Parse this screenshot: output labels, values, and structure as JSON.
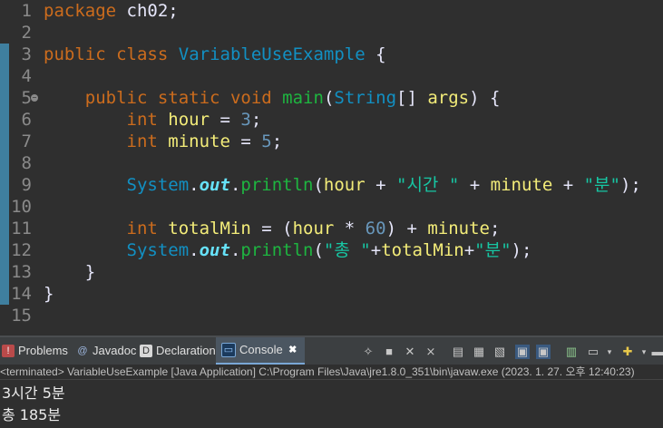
{
  "editor": {
    "lines": [
      {
        "n": "1",
        "tokens": [
          [
            "kw",
            "package"
          ],
          [
            "op",
            " ch02;"
          ]
        ]
      },
      {
        "n": "2",
        "tokens": []
      },
      {
        "n": "3",
        "tokens": [
          [
            "kw",
            "public"
          ],
          [
            "op",
            " "
          ],
          [
            "kw",
            "class"
          ],
          [
            "op",
            " "
          ],
          [
            "cls",
            "VariableUseExample"
          ],
          [
            "op",
            " {"
          ]
        ]
      },
      {
        "n": "4",
        "tokens": []
      },
      {
        "n": "5",
        "tokens": [
          [
            "op",
            "    "
          ],
          [
            "kw",
            "public"
          ],
          [
            "op",
            " "
          ],
          [
            "kw",
            "static"
          ],
          [
            "op",
            " "
          ],
          [
            "kw",
            "void"
          ],
          [
            "op",
            " "
          ],
          [
            "fn",
            "main"
          ],
          [
            "op",
            "("
          ],
          [
            "cls",
            "String"
          ],
          [
            "op",
            "[] "
          ],
          [
            "var",
            "args"
          ],
          [
            "op",
            ") {"
          ]
        ]
      },
      {
        "n": "6",
        "tokens": [
          [
            "op",
            "        "
          ],
          [
            "kw",
            "int"
          ],
          [
            "op",
            " "
          ],
          [
            "var",
            "hour"
          ],
          [
            "op",
            " = "
          ],
          [
            "num",
            "3"
          ],
          [
            "op",
            ";"
          ]
        ]
      },
      {
        "n": "7",
        "tokens": [
          [
            "op",
            "        "
          ],
          [
            "kw",
            "int"
          ],
          [
            "op",
            " "
          ],
          [
            "var",
            "minute"
          ],
          [
            "op",
            " = "
          ],
          [
            "num",
            "5"
          ],
          [
            "op",
            ";"
          ]
        ]
      },
      {
        "n": "8",
        "tokens": []
      },
      {
        "n": "9",
        "tokens": [
          [
            "op",
            "        "
          ],
          [
            "cls",
            "System"
          ],
          [
            "op",
            "."
          ],
          [
            "field",
            "out"
          ],
          [
            "op",
            "."
          ],
          [
            "fn",
            "println"
          ],
          [
            "op",
            "("
          ],
          [
            "var",
            "hour"
          ],
          [
            "op",
            " + "
          ],
          [
            "str",
            "\"시간 \""
          ],
          [
            "op",
            " + "
          ],
          [
            "var",
            "minute"
          ],
          [
            "op",
            " + "
          ],
          [
            "str",
            "\"분\""
          ],
          [
            "op",
            ");"
          ]
        ]
      },
      {
        "n": "10",
        "tokens": []
      },
      {
        "n": "11",
        "tokens": [
          [
            "op",
            "        "
          ],
          [
            "kw",
            "int"
          ],
          [
            "op",
            " "
          ],
          [
            "var",
            "totalMin"
          ],
          [
            "op",
            " = ("
          ],
          [
            "var",
            "hour"
          ],
          [
            "op",
            " * "
          ],
          [
            "num",
            "60"
          ],
          [
            "op",
            ") + "
          ],
          [
            "var",
            "minute"
          ],
          [
            "op",
            ";"
          ]
        ]
      },
      {
        "n": "12",
        "tokens": [
          [
            "op",
            "        "
          ],
          [
            "cls",
            "System"
          ],
          [
            "op",
            "."
          ],
          [
            "field",
            "out"
          ],
          [
            "op",
            "."
          ],
          [
            "fn",
            "println"
          ],
          [
            "op",
            "("
          ],
          [
            "str",
            "\"총 \""
          ],
          [
            "op",
            "+"
          ],
          [
            "var",
            "totalMin"
          ],
          [
            "op",
            "+"
          ],
          [
            "str",
            "\"분\""
          ],
          [
            "op",
            ");"
          ]
        ]
      },
      {
        "n": "13",
        "tokens": [
          [
            "op",
            "    }"
          ]
        ]
      },
      {
        "n": "14",
        "tokens": [
          [
            "op",
            "}"
          ]
        ]
      },
      {
        "n": "15",
        "tokens": []
      }
    ]
  },
  "tabs": {
    "problems": "Problems",
    "javadoc": "Javadoc",
    "declaration": "Declaration",
    "console": "Console"
  },
  "icons": {
    "problems": "problems-icon",
    "javadoc": "javadoc-icon",
    "declaration": "declaration-icon",
    "console": "console-icon",
    "close": "close-icon"
  },
  "console": {
    "status": "<terminated> VariableUseExample [Java Application] C:\\Program Files\\Java\\jre1.8.0_351\\bin\\javaw.exe  (2023. 1. 27. 오후 12:40:23)",
    "output": [
      "3시간 5분",
      "총 185분"
    ]
  }
}
